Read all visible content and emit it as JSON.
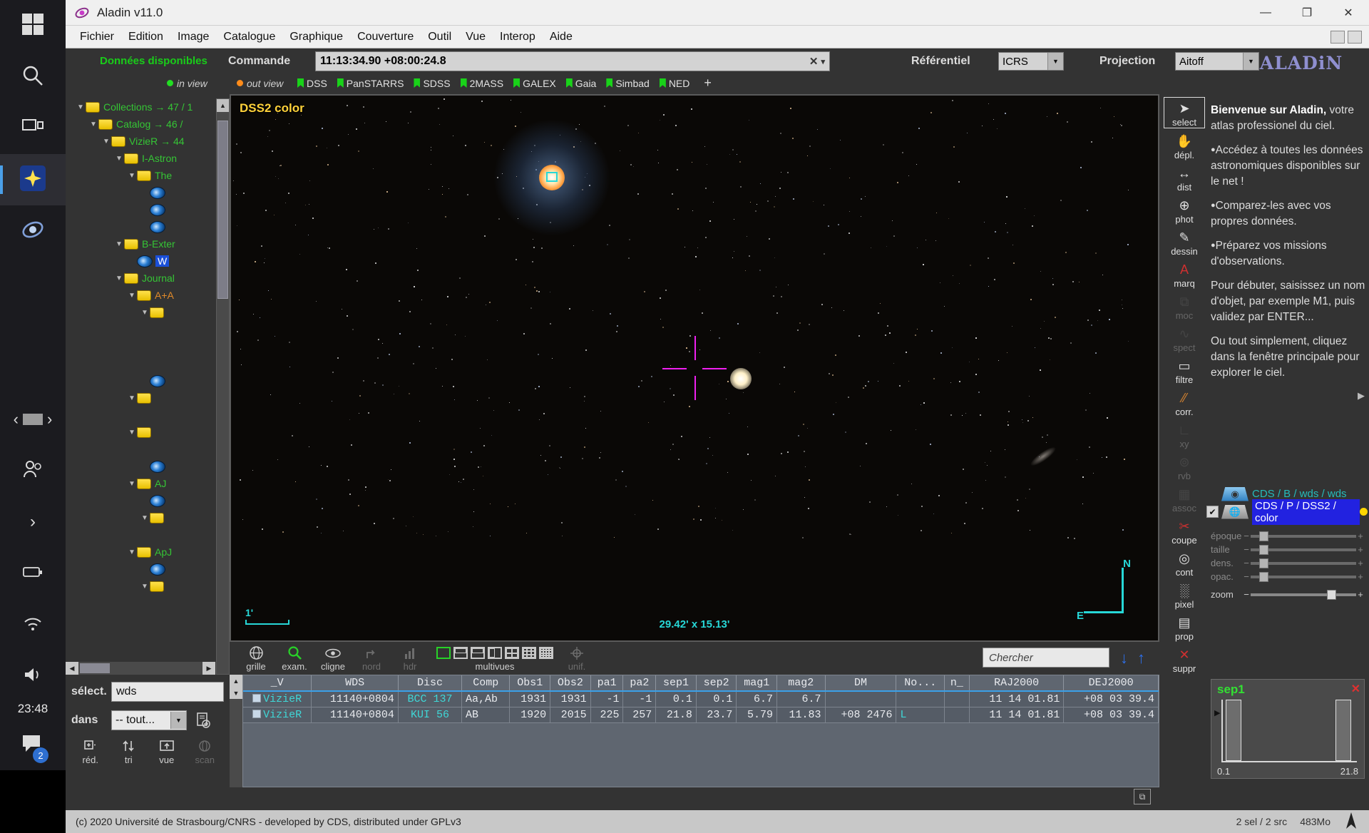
{
  "taskbar": {
    "items": [
      {
        "name": "start",
        "icon": "windows-icon"
      },
      {
        "name": "search",
        "icon": "search-icon"
      },
      {
        "name": "task-view",
        "icon": "taskview-icon"
      },
      {
        "name": "app-star",
        "icon": "star-app-icon"
      },
      {
        "name": "app-aladin",
        "icon": "aladin-app-icon"
      }
    ],
    "nav_back": "‹",
    "nav_fwd": "›",
    "people_icon": "people-icon",
    "chevron": "›",
    "clock": "23:48",
    "chat_badge": "2"
  },
  "window": {
    "title": "Aladin v11.0",
    "minimize": "—",
    "maximize": "❐",
    "close": "✕"
  },
  "menubar": {
    "items": [
      "Fichier",
      "Edition",
      "Image",
      "Catalogue",
      "Graphique",
      "Couverture",
      "Outil",
      "Vue",
      "Interop",
      "Aide"
    ]
  },
  "command": {
    "available_label": "Données disponibles",
    "command_label": "Commande",
    "value": "11:13:34.90 +08:00:24.8",
    "clear_icon": "✕",
    "dropdown_icon": "▾",
    "referentiel_label": "Référentiel",
    "referentiel_value": "ICRS",
    "projection_label": "Projection",
    "projection_value": "Aitoff",
    "logo": "ALADiN"
  },
  "legend": {
    "in_view": "in view",
    "out_view": "out view",
    "in_view_color": "#22dd22",
    "out_view_color": "#ff8c1a"
  },
  "surveys": {
    "items": [
      "DSS",
      "PanSTARRS",
      "SDSS",
      "2MASS",
      "GALEX",
      "Gaia",
      "Simbad",
      "NED"
    ],
    "add": "+"
  },
  "tree": {
    "nodes": [
      {
        "depth": 0,
        "type": "folder",
        "label": "Collections → 47 / 1",
        "color": "green"
      },
      {
        "depth": 1,
        "type": "folder",
        "label": "Catalog → 46 /",
        "color": "green"
      },
      {
        "depth": 2,
        "type": "folder",
        "label": "VizieR → 44",
        "color": "green"
      },
      {
        "depth": 3,
        "type": "folder",
        "label": "I-Astron",
        "color": "green"
      },
      {
        "depth": 4,
        "type": "folder",
        "label": "The",
        "color": "green"
      },
      {
        "depth": 5,
        "type": "cat",
        "label": "",
        "color": "green"
      },
      {
        "depth": 5,
        "type": "cat",
        "label": "",
        "color": "green"
      },
      {
        "depth": 5,
        "type": "cat",
        "label": "",
        "color": "green"
      },
      {
        "depth": 3,
        "type": "folder",
        "label": "B-Exter",
        "color": "green"
      },
      {
        "depth": 4,
        "type": "cat",
        "label": "W",
        "color": "hl"
      },
      {
        "depth": 3,
        "type": "folder",
        "label": "Journal",
        "color": "green"
      },
      {
        "depth": 4,
        "type": "folder",
        "label": "A+A",
        "color": "orange"
      },
      {
        "depth": 5,
        "type": "folder",
        "label": "",
        "color": "green"
      },
      {
        "depth": 0,
        "type": "blank",
        "label": "",
        "color": "green"
      },
      {
        "depth": 0,
        "type": "blank",
        "label": "",
        "color": "green"
      },
      {
        "depth": 0,
        "type": "blank",
        "label": "",
        "color": "green"
      },
      {
        "depth": 5,
        "type": "cat",
        "label": "",
        "color": "green"
      },
      {
        "depth": 4,
        "type": "folder",
        "label": "",
        "color": "green"
      },
      {
        "depth": 0,
        "type": "blank",
        "label": "",
        "color": "green"
      },
      {
        "depth": 4,
        "type": "folder",
        "label": "",
        "color": "green"
      },
      {
        "depth": 0,
        "type": "blank",
        "label": "",
        "color": "green"
      },
      {
        "depth": 5,
        "type": "cat",
        "label": "",
        "color": "green"
      },
      {
        "depth": 4,
        "type": "folder",
        "label": "AJ",
        "color": "green"
      },
      {
        "depth": 5,
        "type": "cat",
        "label": "",
        "color": "green"
      },
      {
        "depth": 5,
        "type": "folder",
        "label": "",
        "color": "green"
      },
      {
        "depth": 0,
        "type": "blank",
        "label": "",
        "color": "green"
      },
      {
        "depth": 4,
        "type": "folder",
        "label": "ApJ",
        "color": "green"
      },
      {
        "depth": 5,
        "type": "cat",
        "label": "",
        "color": "green"
      },
      {
        "depth": 5,
        "type": "folder",
        "label": "",
        "color": "green"
      }
    ]
  },
  "view": {
    "survey_label": "DSS2 color",
    "scale_label": "1'",
    "fov_label": "29.42' x 15.13'",
    "compass_n": "N",
    "compass_e": "E"
  },
  "viewtools": {
    "items": [
      {
        "label": "grille",
        "icon": "globe-grid-icon",
        "state": "normal"
      },
      {
        "label": "exam.",
        "icon": "magnifier-icon",
        "state": "active"
      },
      {
        "label": "cligne",
        "icon": "eye-icon",
        "state": "normal"
      },
      {
        "label": "nord",
        "icon": "north-arrow-icon",
        "state": "dim"
      },
      {
        "label": "hdr",
        "icon": "histogram-icon",
        "state": "dim"
      }
    ],
    "multivues_label": "multivues",
    "unit_label": "unif.",
    "search_placeholder": "Chercher",
    "down_arrow": "↓",
    "up_arrow": "↑"
  },
  "righttools": {
    "items": [
      {
        "label": "select",
        "icon": "cursor-arrow-icon",
        "state": "selected"
      },
      {
        "label": "dépl.",
        "icon": "hand-icon",
        "state": "normal"
      },
      {
        "label": "dist",
        "icon": "distance-icon",
        "state": "normal"
      },
      {
        "label": "phot",
        "icon": "photometry-icon",
        "state": "normal"
      },
      {
        "label": "dessin",
        "icon": "pencil-icon",
        "state": "normal"
      },
      {
        "label": "marq",
        "icon": "label-a-icon",
        "state": "normal"
      },
      {
        "label": "moc",
        "icon": "moc-icon",
        "state": "dim"
      },
      {
        "label": "spect",
        "icon": "spectrum-icon",
        "state": "dim"
      },
      {
        "label": "filtre",
        "icon": "filter-icon",
        "state": "normal"
      },
      {
        "label": "corr.",
        "icon": "match-icon",
        "state": "normal"
      },
      {
        "label": "xy",
        "icon": "xy-plot-icon",
        "state": "dim"
      },
      {
        "label": "rvb",
        "icon": "rgb-icon",
        "state": "dim"
      },
      {
        "label": "assoc",
        "icon": "assoc-icon",
        "state": "dim"
      },
      {
        "label": "coupe",
        "icon": "cut-icon",
        "state": "normal"
      },
      {
        "label": "cont",
        "icon": "contour-icon",
        "state": "normal"
      },
      {
        "label": "pixel",
        "icon": "pixel-histogram-icon",
        "state": "normal"
      },
      {
        "label": "prop",
        "icon": "properties-icon",
        "state": "normal"
      },
      {
        "label": "suppr",
        "icon": "delete-x-icon",
        "state": "normal"
      }
    ]
  },
  "welcome": {
    "title": "Bienvenue sur Aladin,",
    "subtitle": "votre atlas professionel du ciel.",
    "bullets": [
      "Accédez à toutes les données astronomiques disponibles sur le net !",
      "Comparez-les avec vos propres données.",
      "Préparez vos missions d'observations."
    ],
    "para1": "Pour débuter, saisissez un nom d'objet, par exemple M1, puis validez par ENTER...",
    "para2": "Ou tout simplement, cliquez dans la fenêtre principale pour explorer le ciel.",
    "more_icon": "▶"
  },
  "stack": {
    "layers": [
      {
        "name": "CDS / B / wds / wds",
        "checked": false,
        "selected": false,
        "icon": "catalog-layer-icon"
      },
      {
        "name": "CDS / P / DSS2 / color",
        "checked": true,
        "selected": true,
        "icon": "image-layer-icon"
      }
    ],
    "sliders": [
      {
        "label": "époque",
        "value": 8
      },
      {
        "label": "taille",
        "value": 8
      },
      {
        "label": "dens.",
        "value": 8
      },
      {
        "label": "opac.",
        "value": 8
      }
    ],
    "zoom_label": "zoom",
    "zoom_value": 72,
    "minus": "−",
    "plus": "+"
  },
  "table": {
    "columns": [
      "_V",
      "WDS",
      "Disc",
      "Comp",
      "Obs1",
      "Obs2",
      "pa1",
      "pa2",
      "sep1",
      "sep2",
      "mag1",
      "mag2",
      "DM",
      "No...",
      "n_",
      "RAJ2000",
      "DEJ2000"
    ],
    "rows": [
      {
        "_V": "VizieR",
        "WDS": "11140+0804",
        "Disc": "BCC  137",
        "Comp": "Aa,Ab",
        "Obs1": "1931",
        "Obs2": "1931",
        "pa1": "-1",
        "pa2": "-1",
        "sep1": "0.1",
        "sep2": "0.1",
        "mag1": "6.7",
        "mag2": "6.7",
        "DM": "",
        "No": "",
        "n_": "",
        "RAJ2000": "11 14 01.81",
        "DEJ2000": "+08 03 39.4"
      },
      {
        "_V": "VizieR",
        "WDS": "11140+0804",
        "Disc": "KUI   56",
        "Comp": "AB",
        "Obs1": "1920",
        "Obs2": "2015",
        "pa1": "225",
        "pa2": "257",
        "sep1": "21.8",
        "sep2": "23.7",
        "mag1": "5.79",
        "mag2": "11.83",
        "DM": "+08 2476",
        "No": "L",
        "n_": "",
        "RAJ2000": "11 14 01.81",
        "DEJ2000": "+08 03 39.4"
      }
    ]
  },
  "chart_data": {
    "type": "bar",
    "title": "sep1",
    "categories": [
      "0.1",
      "21.8"
    ],
    "values": [
      1,
      1
    ],
    "xlabel": "",
    "ylabel": "",
    "axis_min": "0.1",
    "axis_max": "21.8",
    "close_icon": "✕"
  },
  "selector": {
    "select_label": "sélect.",
    "select_value": "wds",
    "in_label": "dans",
    "in_value": "-- tout...",
    "dropdown_icon": "▼",
    "export_icon": "export-icon",
    "buttons": [
      {
        "label": "réd.",
        "icon": "reduce-icon",
        "state": "normal"
      },
      {
        "label": "tri",
        "icon": "sort-icon",
        "state": "normal"
      },
      {
        "label": "vue",
        "icon": "view-icon",
        "state": "normal"
      },
      {
        "label": "scan",
        "icon": "scan-icon",
        "state": "dim"
      }
    ],
    "expand_icon": "⧉"
  },
  "status": {
    "copyright": "(c) 2020 Université de Strasbourg/CNRS - developed by CDS, distributed under GPLv3",
    "selection": "2 sel / 2 src",
    "memory": "483Mo"
  }
}
